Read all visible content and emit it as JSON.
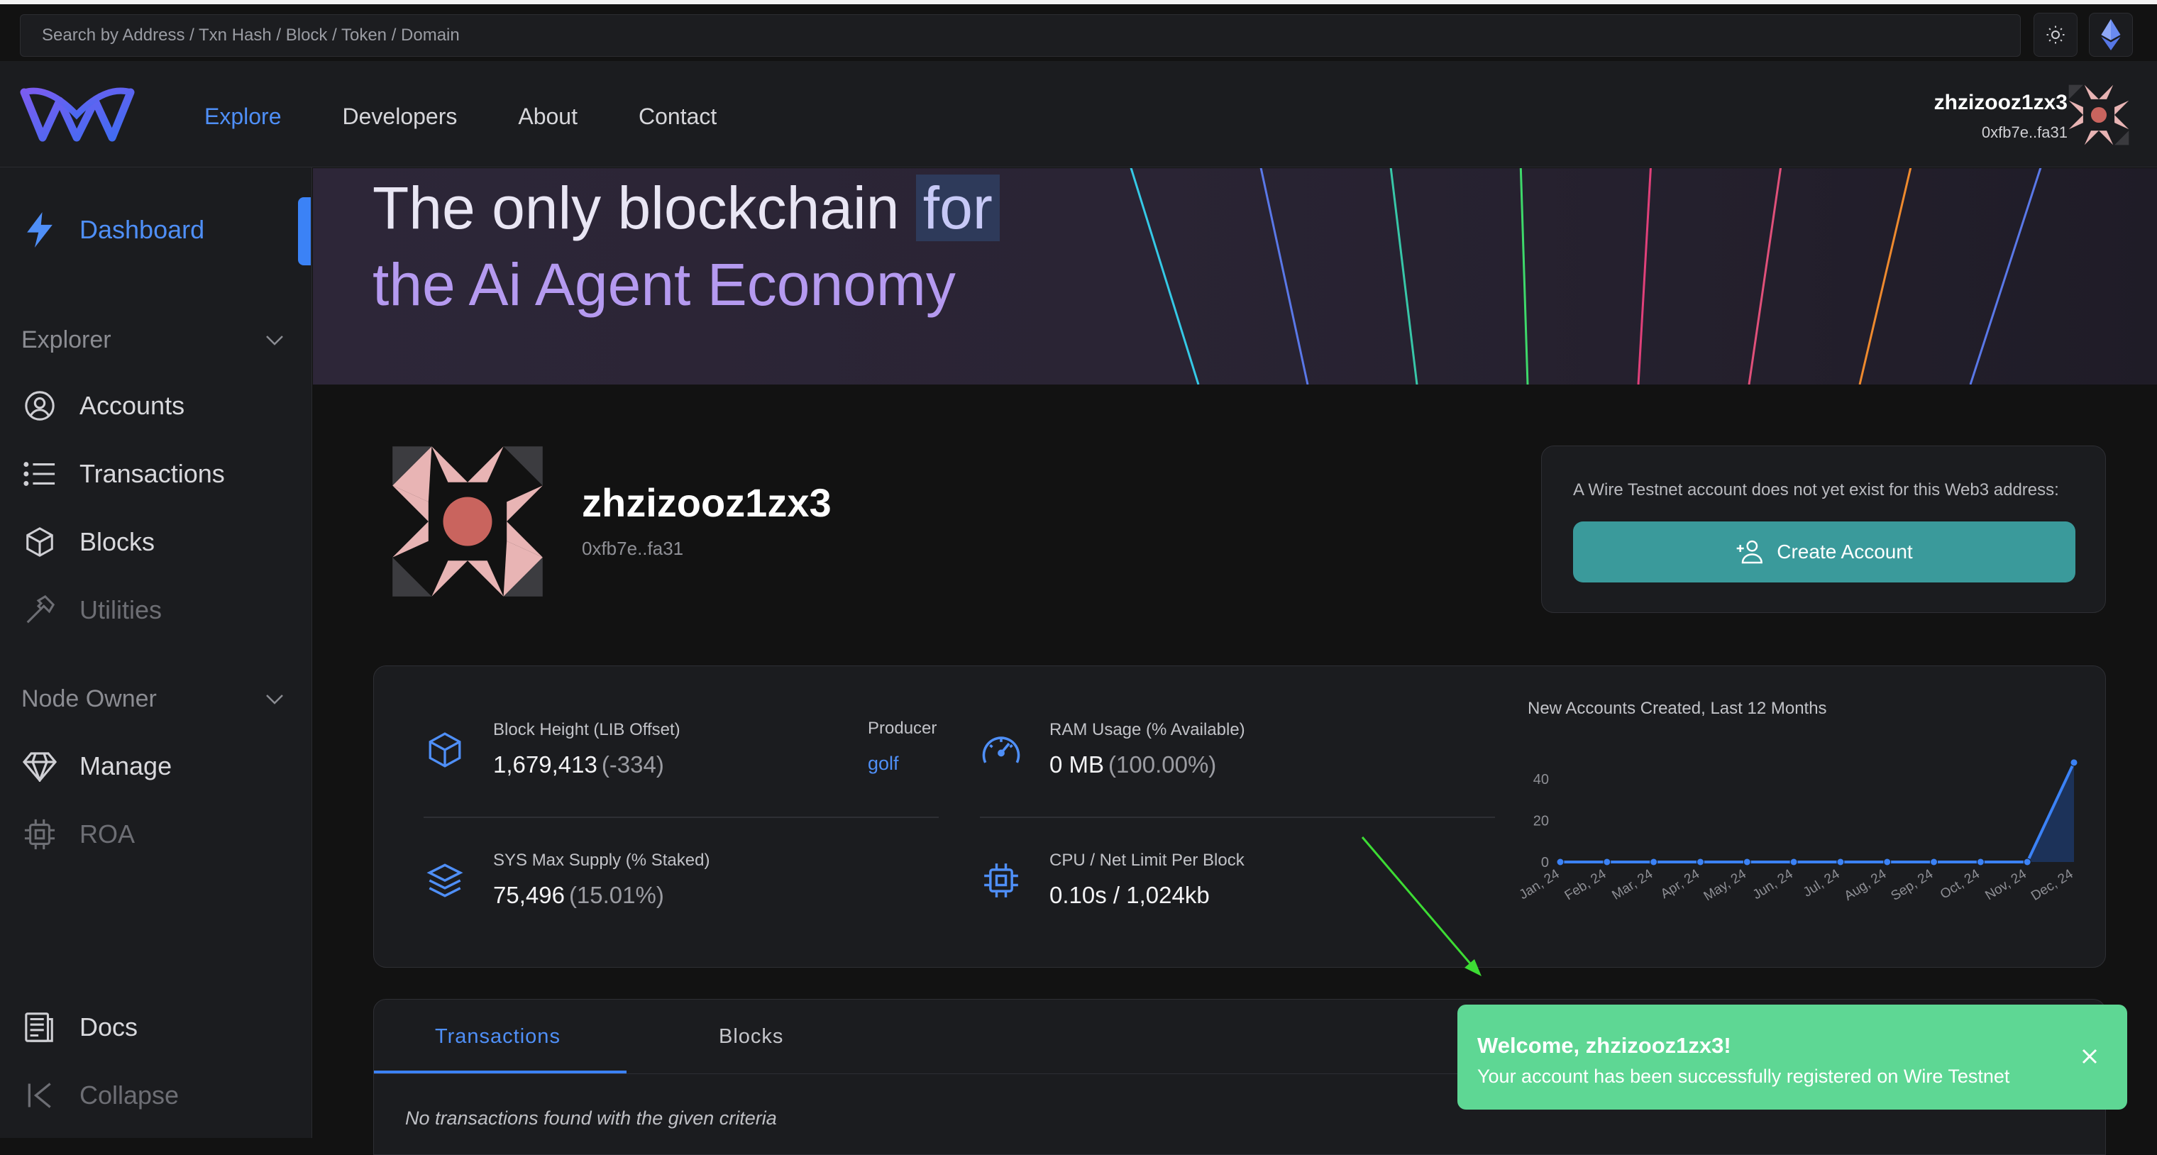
{
  "search": {
    "placeholder": "Search by Address / Txn Hash / Block / Token / Domain"
  },
  "header": {
    "nav": [
      "Explore",
      "Developers",
      "About",
      "Contact"
    ],
    "user": {
      "name": "zhzizooz1zx3",
      "address": "0xfb7e..fa31"
    }
  },
  "sidebar": {
    "dashboard": "Dashboard",
    "explorer_group": "Explorer",
    "explorer_items": [
      "Accounts",
      "Transactions",
      "Blocks",
      "Utilities"
    ],
    "node_owner_group": "Node Owner",
    "node_owner_items": [
      "Manage",
      "ROA"
    ],
    "docs": "Docs",
    "collapse": "Collapse"
  },
  "banner": {
    "line1_main": "The only blockchain ",
    "line1_highlight": "for",
    "line2": "the Ai Agent Economy"
  },
  "profile": {
    "name": "zhzizooz1zx3",
    "address": "0xfb7e..fa31"
  },
  "create_account": {
    "message": "A Wire Testnet account does not yet exist for this Web3 address:",
    "button_label": "Create Account"
  },
  "stats": {
    "block_height": {
      "label": "Block Height (LIB Offset)",
      "value": "1,679,413",
      "sub": "(-334)"
    },
    "producer": {
      "label": "Producer",
      "value": "golf"
    },
    "ram": {
      "label": "RAM Usage (% Available)",
      "value": "0 MB",
      "sub": "(100.00%)"
    },
    "sys_supply": {
      "label": "SYS Max Supply (% Staked)",
      "value": "75,496",
      "sub": "(15.01%)"
    },
    "cpu_net": {
      "label": "CPU / Net Limit Per Block",
      "value": "0.10s  /  1,024kb"
    }
  },
  "chart_data": {
    "type": "area",
    "title": "New Accounts Created, Last 12 Months",
    "categories": [
      "Jan, 24",
      "Feb, 24",
      "Mar, 24",
      "Apr, 24",
      "May, 24",
      "Jun, 24",
      "Jul, 24",
      "Aug, 24",
      "Sep, 24",
      "Oct, 24",
      "Nov, 24",
      "Dec, 24"
    ],
    "values": [
      0,
      0,
      0,
      0,
      0,
      0,
      0,
      0,
      0,
      0,
      0,
      48
    ],
    "yticks": [
      0,
      20,
      40
    ],
    "ylim": [
      0,
      50
    ],
    "color": "#3b82f6"
  },
  "tabs": {
    "items": [
      "Transactions",
      "Blocks"
    ],
    "active": "Transactions",
    "empty_message": "No transactions found with the given criteria"
  },
  "toast": {
    "title": "Welcome, zhzizooz1zx3!",
    "message": "Your account has been successfully registered on Wire Testnet"
  },
  "colors": {
    "accent": "#3b82f6",
    "toast": "#5ed794",
    "create_button": "#3a9a9b",
    "annotation_arrow": "#3ddc34"
  }
}
